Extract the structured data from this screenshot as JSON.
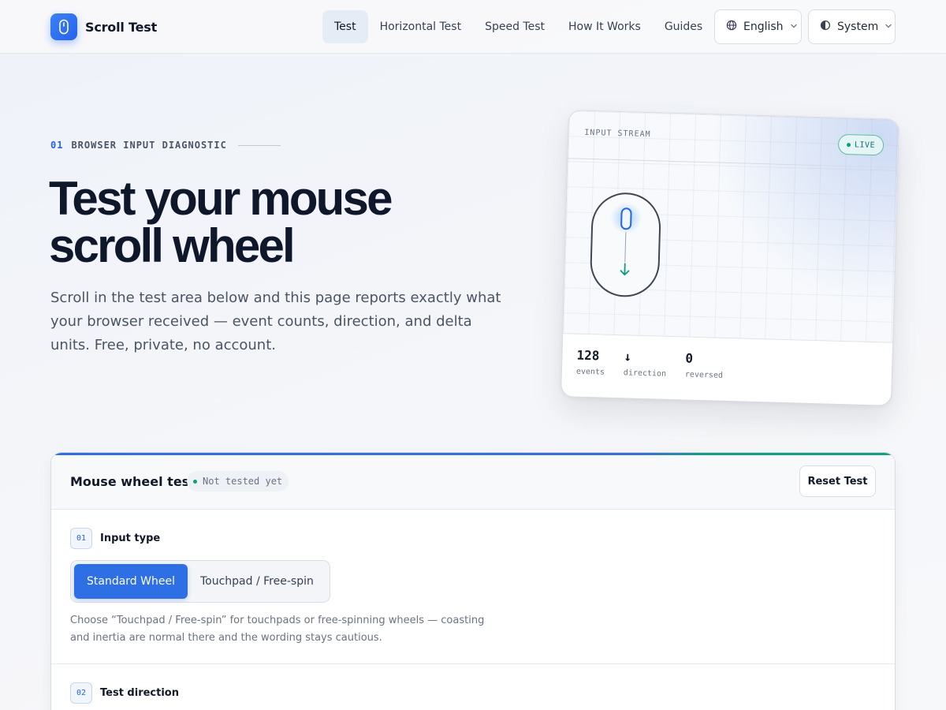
{
  "brand": {
    "name": "Scroll Test",
    "icon": "mouse-icon",
    "color": "#2563eb"
  },
  "nav": {
    "links": [
      {
        "label": "Test"
      },
      {
        "label": "Horizontal Test"
      },
      {
        "label": "Speed Test"
      },
      {
        "label": "How It Works"
      },
      {
        "label": "Guides"
      }
    ],
    "active": "Test",
    "language": {
      "value": "English",
      "icon": "globe-icon"
    },
    "theme": {
      "value": "System",
      "icon": "contrast-icon"
    }
  },
  "hero": {
    "kicker_num": "01",
    "kicker_label": "BROWSER INPUT DIAGNOSTIC",
    "title_line1": "Test your mouse",
    "title_line2": "scroll wheel",
    "subtitle": "Scroll in the test area below and this page reports exactly what your browser received — event counts, direction, and delta units. Free, private, no account."
  },
  "stream_card": {
    "label": "INPUT STREAM",
    "badge": "LIVE",
    "stats": [
      {
        "value": "128",
        "label": "events"
      },
      {
        "value": "↓",
        "label": "direction"
      },
      {
        "value": "0",
        "label": "reversed"
      }
    ],
    "wave_colors": [
      "#3b82f6",
      "#14b8a6"
    ]
  },
  "test_panel": {
    "title": "Mouse wheel test",
    "status": "Not tested yet",
    "reset_label": "Reset Test",
    "sections": [
      {
        "num": "01",
        "label": "Input type",
        "options": [
          "Standard Wheel",
          "Touchpad / Free-spin"
        ],
        "selected": "Standard Wheel",
        "hint": "Choose “Touchpad / Free-spin” for touchpads or free-spinning wheels — coasting and inertia are normal there and the wording stays cautious."
      },
      {
        "num": "02",
        "label": "Test direction"
      }
    ]
  }
}
